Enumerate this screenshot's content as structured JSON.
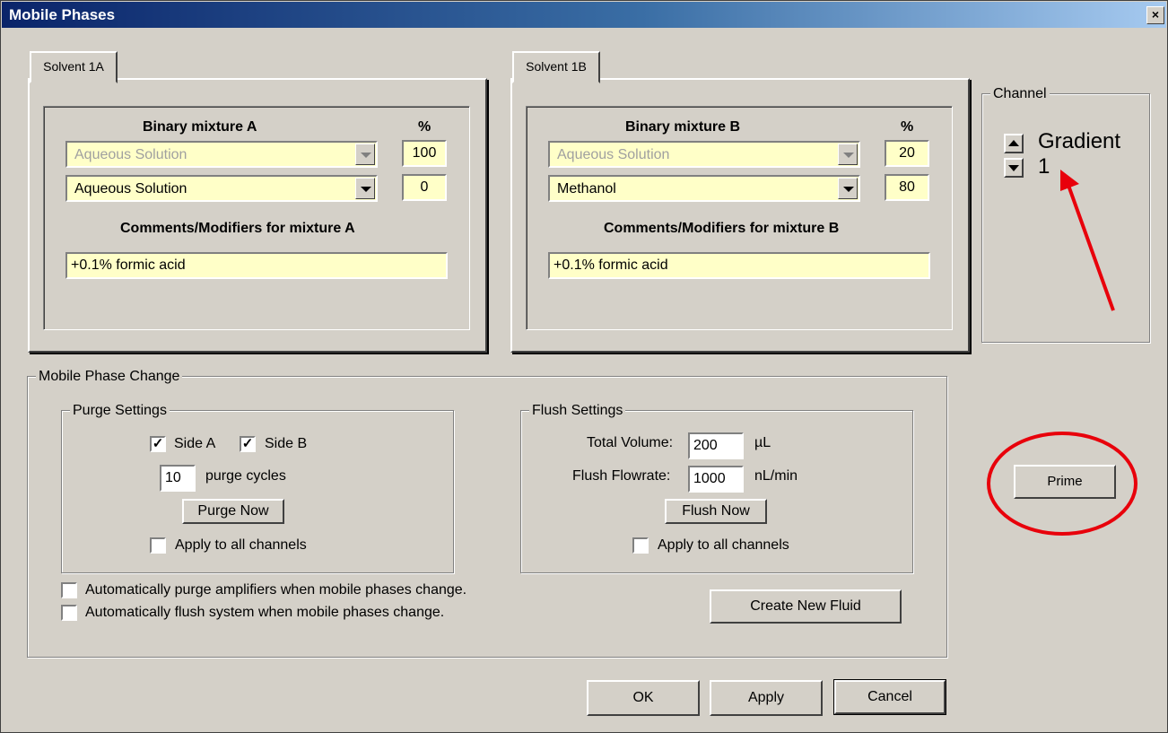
{
  "window": {
    "title": "Mobile Phases",
    "close": "×"
  },
  "solvent_a": {
    "tab_label": "Solvent 1A",
    "heading": "Binary mixture A",
    "pct_heading": "%",
    "row1": {
      "solvent": "Aqueous Solution",
      "pct": "100"
    },
    "row2": {
      "solvent": "Aqueous Solution",
      "pct": "0"
    },
    "comments_label": "Comments/Modifiers for mixture A",
    "comments": "+0.1% formic acid"
  },
  "solvent_b": {
    "tab_label": "Solvent 1B",
    "heading": "Binary mixture B",
    "pct_heading": "%",
    "row1": {
      "solvent": "Aqueous Solution",
      "pct": "20"
    },
    "row2": {
      "solvent": "Methanol",
      "pct": "80"
    },
    "comments_label": "Comments/Modifiers for mixture B",
    "comments": "+0.1% formic acid"
  },
  "channel": {
    "label": "Channel",
    "line1": "Gradient",
    "line2": "1"
  },
  "mobile_phase_change": {
    "label": "Mobile Phase Change",
    "purge": {
      "label": "Purge Settings",
      "side_a": {
        "label": "Side A",
        "checked": true
      },
      "side_b": {
        "label": "Side B",
        "checked": true
      },
      "cycles_value": "10",
      "cycles_label": "purge cycles",
      "purge_now": "Purge Now",
      "apply_all": {
        "label": "Apply to all channels",
        "checked": false
      }
    },
    "flush": {
      "label": "Flush Settings",
      "total_volume_label": "Total Volume:",
      "total_volume": "200",
      "total_volume_unit": "µL",
      "flowrate_label": "Flush Flowrate:",
      "flowrate": "1000",
      "flowrate_unit": "nL/min",
      "flush_now": "Flush Now",
      "apply_all": {
        "label": "Apply to all channels",
        "checked": false
      }
    },
    "auto_purge": {
      "label": "Automatically purge amplifiers when mobile phases change.",
      "checked": false
    },
    "auto_flush": {
      "label": "Automatically flush system when mobile phases change.",
      "checked": false
    },
    "create_fluid": "Create New Fluid"
  },
  "prime_button": "Prime",
  "footer": {
    "ok": "OK",
    "apply": "Apply",
    "cancel": "Cancel"
  },
  "check_glyph": "✓",
  "colors": {
    "field_bg": "#ffffc8",
    "dialog_bg": "#d4d0c8",
    "annotation": "#e8000b",
    "title_start": "#0a246a",
    "title_end": "#a6caf0"
  }
}
